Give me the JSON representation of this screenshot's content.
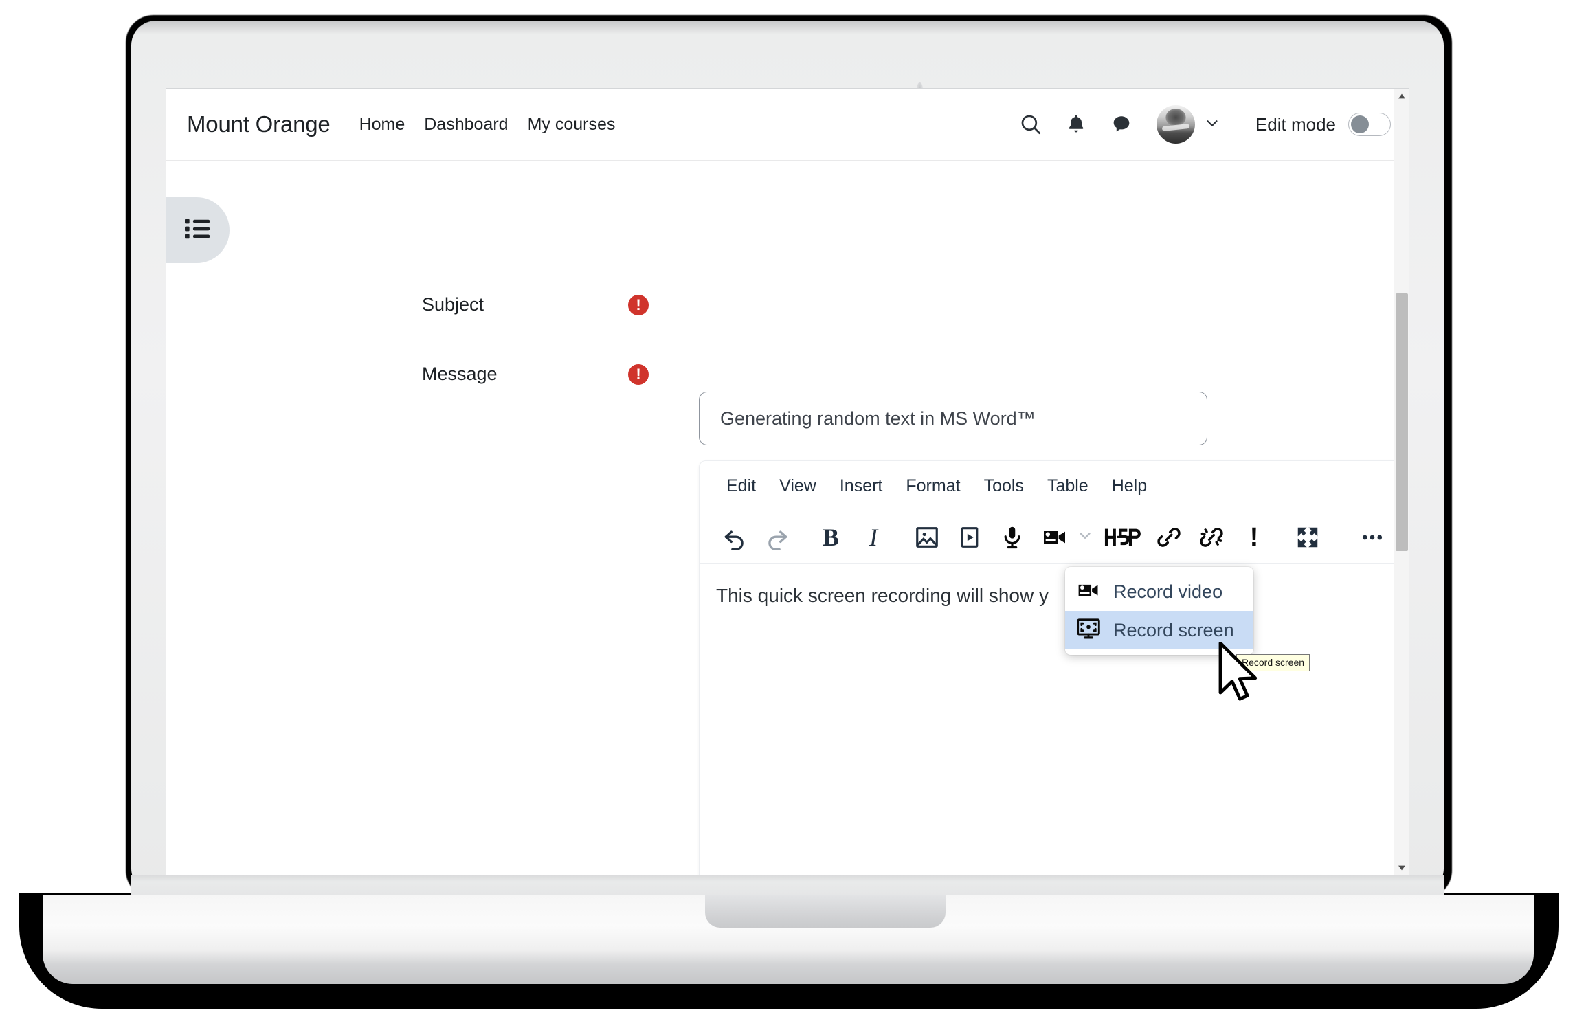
{
  "navbar": {
    "site_name": "Mount Orange",
    "links": [
      {
        "label": "Home"
      },
      {
        "label": "Dashboard"
      },
      {
        "label": "My courses"
      }
    ],
    "icons": {
      "search": "search-icon",
      "notifications": "bell-icon",
      "messages": "message-bubble-icon",
      "user_chevron": "chevron-down-icon"
    },
    "edit_mode": {
      "label": "Edit mode",
      "enabled": false
    }
  },
  "drawer": {
    "toggle_icon": "list-icon"
  },
  "form": {
    "subject": {
      "label": "Subject",
      "required_marker": "!",
      "value": "Generating random text in MS Word™",
      "placeholder": ""
    },
    "message": {
      "label": "Message",
      "required_marker": "!"
    }
  },
  "editor": {
    "menubar": [
      {
        "label": "Edit"
      },
      {
        "label": "View"
      },
      {
        "label": "Insert"
      },
      {
        "label": "Format"
      },
      {
        "label": "Tools"
      },
      {
        "label": "Table"
      },
      {
        "label": "Help"
      }
    ],
    "toolbar": [
      {
        "name": "undo-icon",
        "title": "Undo",
        "disabled": false
      },
      {
        "name": "redo-icon",
        "title": "Redo",
        "disabled": true
      },
      {
        "name": "bold-icon",
        "title": "Bold",
        "label": "B"
      },
      {
        "name": "italic-icon",
        "title": "Italic",
        "label": "I"
      },
      {
        "name": "image-icon",
        "title": "Insert image"
      },
      {
        "name": "media-icon",
        "title": "Insert media"
      },
      {
        "name": "microphone-icon",
        "title": "Record audio"
      },
      {
        "name": "video-camera-icon",
        "title": "Record",
        "has_chevron": true
      },
      {
        "name": "h5p-icon",
        "title": "Insert H5P",
        "label": "H-P"
      },
      {
        "name": "link-icon",
        "title": "Insert link"
      },
      {
        "name": "unlink-icon",
        "title": "Remove link"
      },
      {
        "name": "accessibility-checker-icon",
        "title": "Accessibility checker",
        "label": "!"
      },
      {
        "name": "fullscreen-icon",
        "title": "Fullscreen"
      },
      {
        "name": "more-icon",
        "title": "More…"
      }
    ],
    "body_text": "This quick screen recording will show y"
  },
  "record_menu": {
    "items": [
      {
        "label": "Record video",
        "icon": "video-camera-icon",
        "active": false
      },
      {
        "label": "Record screen",
        "icon": "record-screen-icon",
        "active": true
      }
    ]
  },
  "tooltip": {
    "text": "Record screen"
  },
  "help_button": {
    "label": "?"
  },
  "colors": {
    "required_red": "#d0342c",
    "menu_highlight": "#c9dcf5",
    "icon_dark": "#222f3e",
    "drawer_gray": "#dee2e6",
    "toggle_knob": "#868e96"
  }
}
